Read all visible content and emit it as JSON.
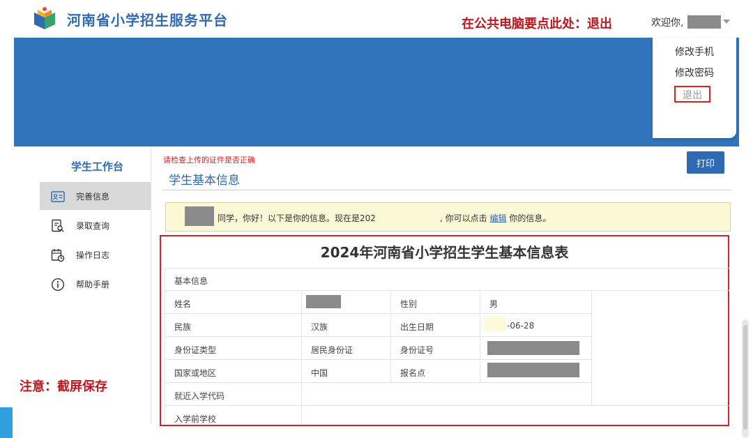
{
  "header": {
    "site_title": "河南省小学招生服务平台",
    "logout_notice": "在公共电脑要点此处：退出",
    "welcome": "欢迎你,"
  },
  "dropdown": {
    "items": [
      "修改手机",
      "修改密码",
      "退出"
    ]
  },
  "sidebar": {
    "title": "学生工作台",
    "items": [
      {
        "label": "完善信息",
        "icon": "id-card-icon",
        "active": true
      },
      {
        "label": "录取查询",
        "icon": "search-document-icon",
        "active": false
      },
      {
        "label": "操作日志",
        "icon": "calendar-clock-icon",
        "active": false
      },
      {
        "label": "帮助手册",
        "icon": "info-icon",
        "active": false
      }
    ]
  },
  "annotation_save": "注意：截屏保存",
  "main": {
    "warning": "请检查上传的证件是否正确",
    "section_title": "学生基本信息",
    "print_label": "打印",
    "info_bar": {
      "text_before": "同学，你好！以下是你的信息。现在是202",
      "text_after": ", 你可以点击",
      "link": "编辑",
      "text_end": "你的信息。"
    },
    "table": {
      "title": "2024年河南省小学招生学生基本信息表",
      "section_label": "基本信息",
      "rows": [
        {
          "label1": "姓名",
          "value1": "",
          "label2": "性别",
          "value2": "男"
        },
        {
          "label1": "民族",
          "value1": "汉族",
          "label2": "出生日期",
          "value2": "-06-28"
        },
        {
          "label1": "身份证类型",
          "value1": "居民身份证",
          "label2": "身份证号",
          "value2": ""
        },
        {
          "label1": "国家或地区",
          "value1": "中国",
          "label2": "报名点",
          "value2": ""
        },
        {
          "label1": "就近入学代码",
          "value1": ""
        },
        {
          "label1": "入学前学校",
          "value1": ""
        }
      ]
    }
  },
  "colors": {
    "brand_blue": "#3174bb",
    "alert_red": "#c0171e",
    "notice_yellow": "#fcf8d6"
  }
}
